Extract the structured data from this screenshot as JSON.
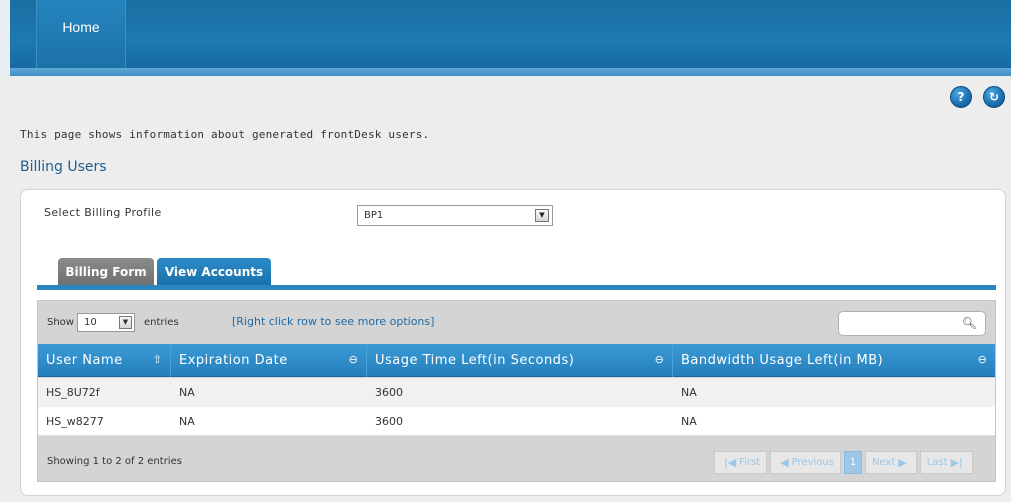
{
  "header": {
    "home_label": "Home"
  },
  "toolbar": {
    "help_icon": "?",
    "refresh_icon": "↻"
  },
  "intro_text": "This page shows information about generated frontDesk users.",
  "section_title": "Billing Users",
  "profile": {
    "label": "Select Billing Profile",
    "selected": "BP1"
  },
  "tabs": [
    {
      "label": "Billing Form",
      "active": false
    },
    {
      "label": "View Accounts",
      "active": true
    }
  ],
  "table": {
    "show_label": "Show",
    "entries_value": "10",
    "entries_label": "entries",
    "hint": "[Right click row to see more options]",
    "search_placeholder": "",
    "columns": [
      {
        "label": "User Name",
        "sort_icon": "⇧"
      },
      {
        "label": "Expiration Date",
        "sort_icon": "⊖"
      },
      {
        "label": "Usage Time Left(in Seconds)",
        "sort_icon": "⊖"
      },
      {
        "label": "Bandwidth Usage Left(in MB)",
        "sort_icon": "⊖"
      }
    ],
    "rows": [
      [
        "HS_8U72f",
        "NA",
        "3600",
        "NA"
      ],
      [
        "HS_w8277",
        "NA",
        "3600",
        "NA"
      ]
    ],
    "info": "Showing 1 to 2 of 2 entries",
    "pager": {
      "first": "First",
      "previous": "Previous",
      "page": "1",
      "next": "Next",
      "last": "Last"
    }
  },
  "colors": {
    "accent": "#1f79b4",
    "header_text": "#ffffff",
    "disabled_pager": "#9cc7e6"
  }
}
